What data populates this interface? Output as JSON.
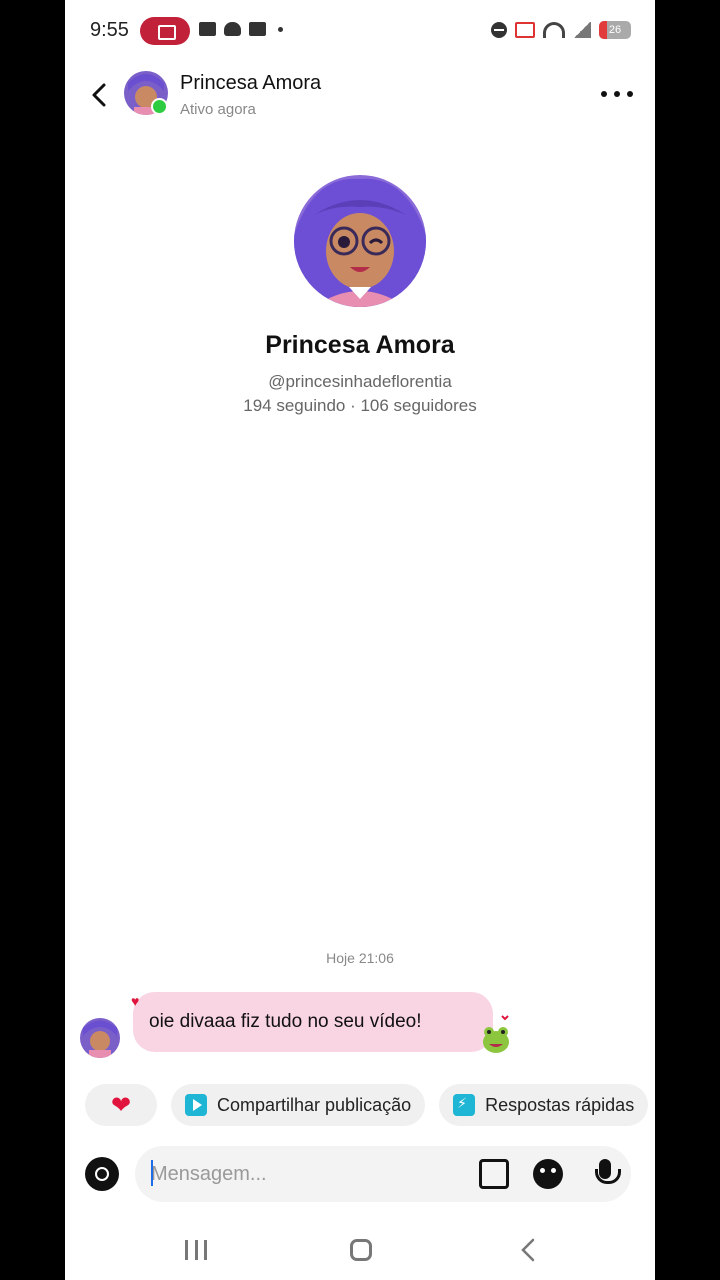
{
  "status_bar": {
    "time": "9:55",
    "battery": "26",
    "icons": [
      "screen-record-icon",
      "video-icon",
      "cloud-icon",
      "calendar-icon",
      "dot-icon",
      "dnd-icon",
      "cast-icon",
      "wifi-icon",
      "signal-icon",
      "battery-icon"
    ]
  },
  "header": {
    "name": "Princesa Amora",
    "status": "Ativo agora"
  },
  "profile": {
    "name": "Princesa Amora",
    "handle": "@princesinhadeflorentia",
    "stats": "194 seguindo · 106 seguidores"
  },
  "chat": {
    "timestamp": "Hoje 21:06",
    "messages": [
      {
        "text": "oie divaaa fiz tudo no seu vídeo!",
        "reaction": "heart"
      }
    ]
  },
  "quick_actions": [
    {
      "icon": "heart-icon",
      "label": "❤"
    },
    {
      "icon": "share-post-icon",
      "label": "Compartilhar publicação"
    },
    {
      "icon": "quick-replies-icon",
      "label": "Respostas rápidas"
    }
  ],
  "composer": {
    "placeholder": "Mensagem..."
  },
  "colors": {
    "bubble": "#f9d4e3",
    "accent": "#1fb5d4",
    "online": "#2ecc40",
    "heart": "#e0143c"
  }
}
